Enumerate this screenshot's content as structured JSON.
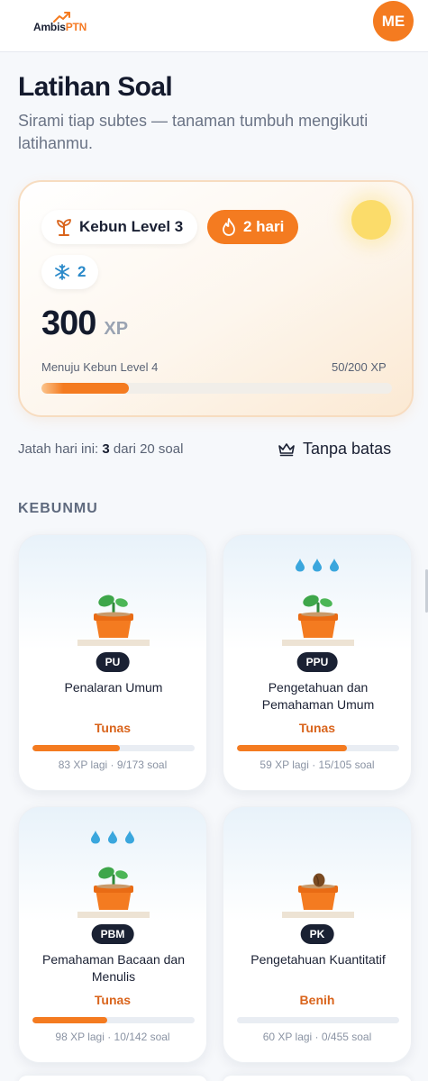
{
  "app": {
    "logo_part1": "Ambis",
    "logo_part2": "PTN",
    "avatar_initials": "ME",
    "accent_color": "#f47b20"
  },
  "header": {
    "title": "Latihan Soal",
    "subtitle": "Sirami tiap subtes — tanaman tumbuh mengikuti latihanmu."
  },
  "progress_card": {
    "level_label": "Kebun Level 3",
    "streak_label": "2 hari",
    "freeze_count": "2",
    "xp_value": "300",
    "xp_unit": "XP",
    "next_level_label": "Menuju Kebun Level 4",
    "next_level_progress": "50/200 XP",
    "next_level_fraction": 0.25,
    "icons": [
      "sprout-icon",
      "flame-icon",
      "snowflake-icon"
    ]
  },
  "quota": {
    "prefix": "Jatah hari ini: ",
    "used": "3",
    "suffix": " dari 20 soal",
    "unlimited_label": "Tanpa batas"
  },
  "garden": {
    "section_label": "KEBUNMU",
    "items": [
      {
        "code": "PU",
        "name": "Penalaran Umum",
        "stage": "Tunas",
        "meta": "83 XP lagi · 9/173 soal",
        "progress": 0.54,
        "watered": false,
        "plant": "sprout"
      },
      {
        "code": "PPU",
        "name": "Pengetahuan dan Pemahaman Umum",
        "stage": "Tunas",
        "meta": "59 XP lagi · 15/105 soal",
        "progress": 0.68,
        "watered": true,
        "plant": "sprout"
      },
      {
        "code": "PBM",
        "name": "Pemahaman Bacaan dan Menulis",
        "stage": "Tunas",
        "meta": "98 XP lagi · 10/142 soal",
        "progress": 0.46,
        "watered": true,
        "plant": "sprout"
      },
      {
        "code": "PK",
        "name": "Pengetahuan Kuantitatif",
        "stage": "Benih",
        "meta": "60 XP lagi · 0/455 soal",
        "progress": 0.0,
        "watered": false,
        "plant": "seed"
      }
    ]
  }
}
